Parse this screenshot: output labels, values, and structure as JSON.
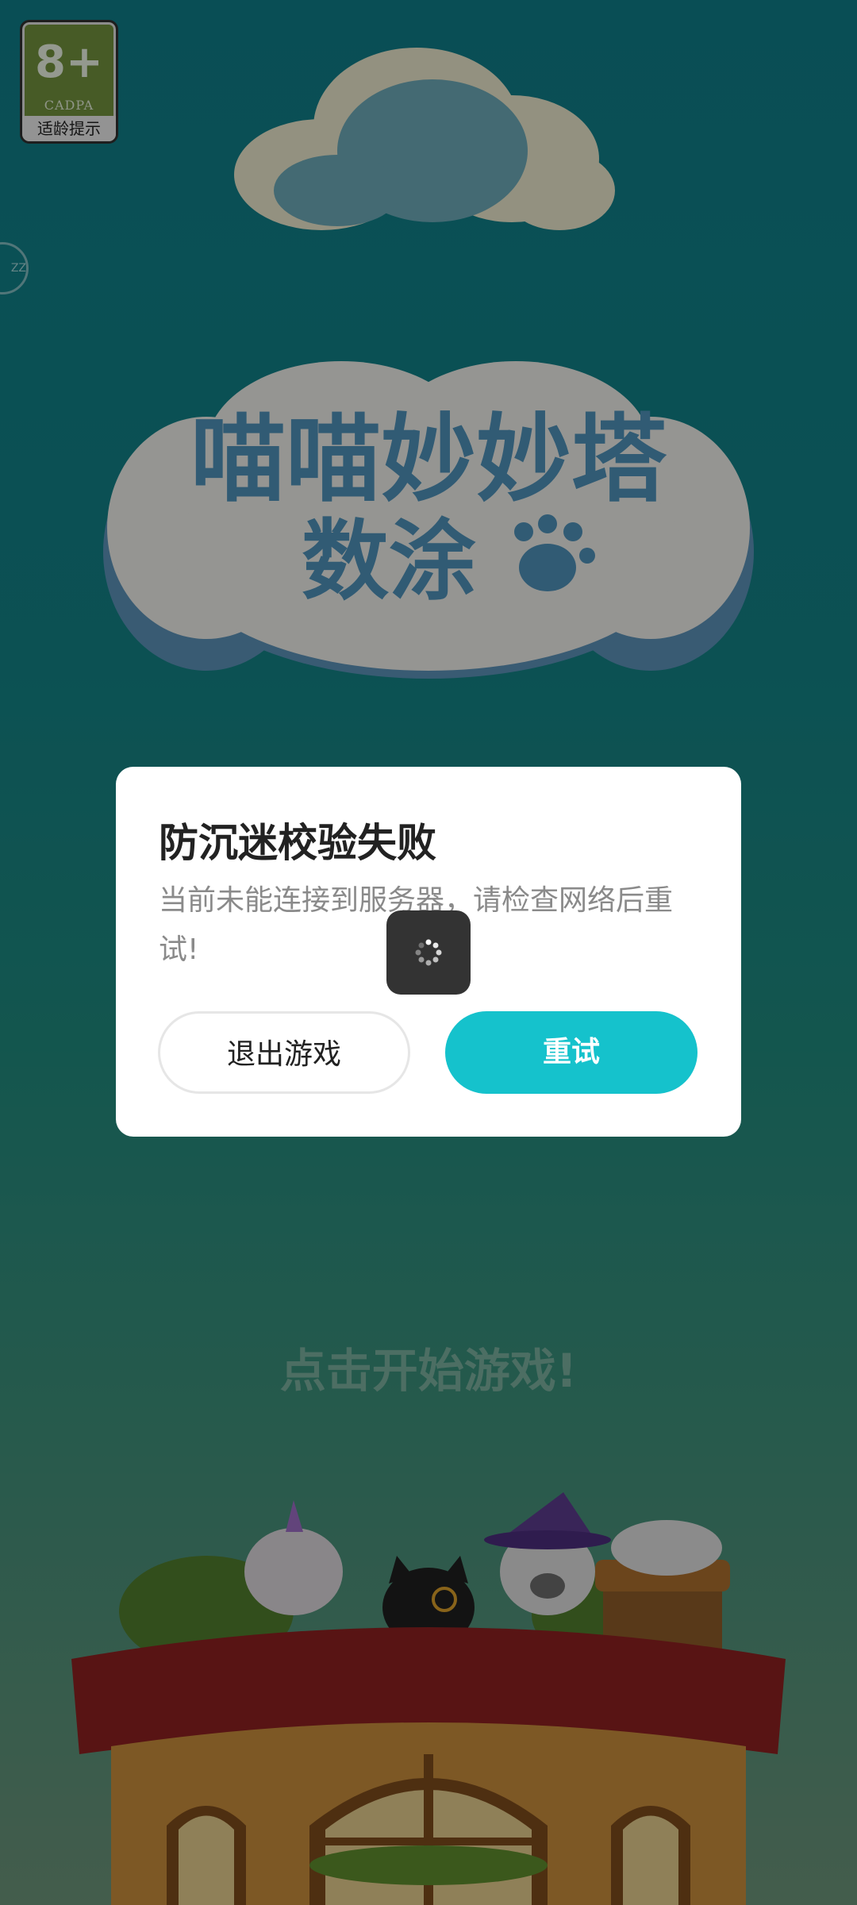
{
  "badge": {
    "age": "8+",
    "org": "CADPA",
    "tip": "适龄提示"
  },
  "side_tab": {
    "label": "ZZ"
  },
  "logo": {
    "line1": "喵喵妙妙塔",
    "line2": "数涂"
  },
  "start_prompt": "点击开始游戏!",
  "dialog": {
    "title": "防沉迷校验失败",
    "message": "当前未能连接到服务器，请检查网络后重试!",
    "exit_label": "退出游戏",
    "retry_label": "重试"
  },
  "colors": {
    "accent": "#15c2cc",
    "badge_green": "#6f8f3c"
  },
  "icons": {
    "loading": "loading-spinner-icon",
    "paw": "paw-icon"
  }
}
